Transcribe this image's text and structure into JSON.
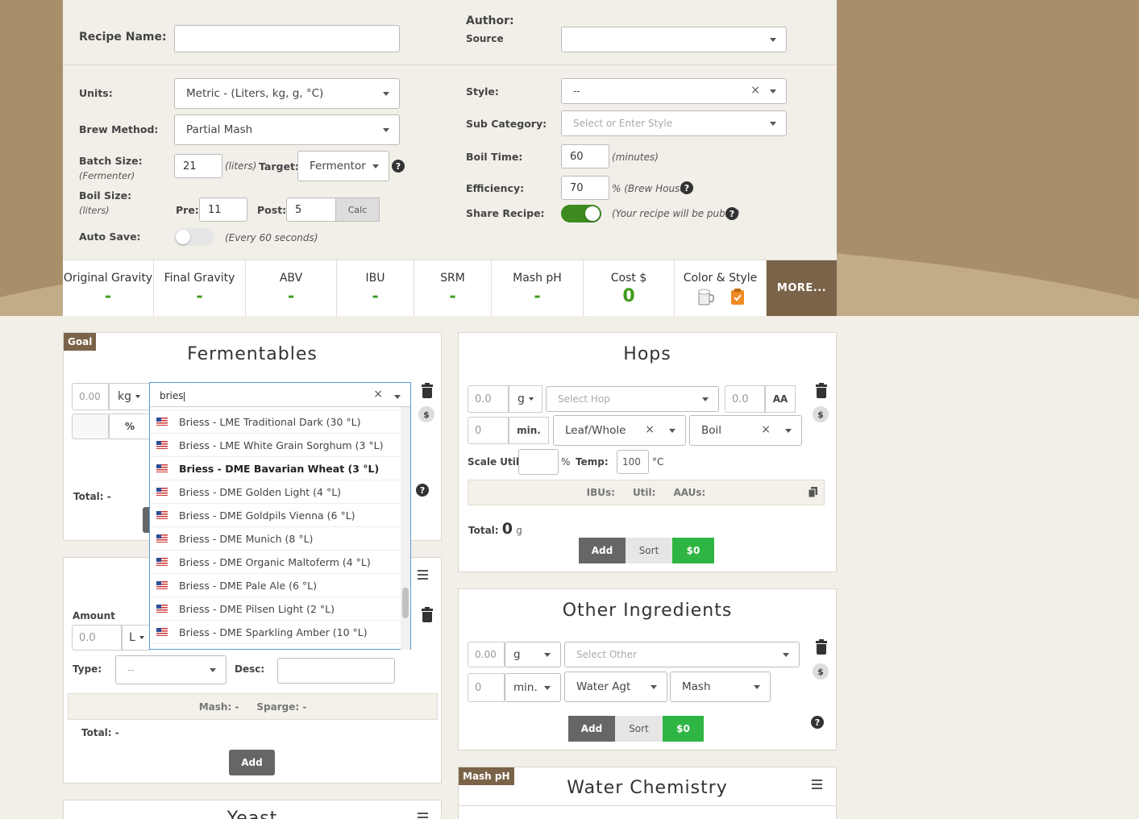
{
  "recipe": {
    "name_label": "Recipe Name:",
    "name_value": "",
    "author_label": "Author:",
    "source_label": "Source",
    "source_value": "",
    "units_label": "Units:",
    "units_value": "Metric - (Liters, kg, g, °C)",
    "method_label": "Brew Method:",
    "method_value": "Partial Mash",
    "batch_label": "Batch Size:",
    "batch_sub": "(Fermenter)",
    "batch_value": "21",
    "batch_unit": "(liters)",
    "target_label": "Target:",
    "target_value": "Fermentor",
    "boil_label": "Boil Size:",
    "boil_sub": "(liters)",
    "pre_label": "Pre:",
    "pre_value": "11",
    "post_label": "Post:",
    "post_value": "5",
    "calc_label": "Calc",
    "autosave_label": "Auto Save:",
    "autosave_note": "(Every 60 seconds)",
    "style_label": "Style:",
    "style_value": "--",
    "subcat_label": "Sub Category:",
    "subcat_placeholder": "Select or Enter Style",
    "boiltime_label": "Boil Time:",
    "boiltime_value": "60",
    "boiltime_unit": "(minutes)",
    "eff_label": "Efficiency:",
    "eff_value": "70",
    "eff_unit": "% (Brew House)",
    "share_label": "Share Recipe:",
    "share_note": "(Your recipe will be public)"
  },
  "stats": {
    "og_label": "Original Gravity",
    "og_value": "-",
    "fg_label": "Final Gravity",
    "fg_value": "-",
    "abv_label": "ABV",
    "abv_value": "-",
    "ibu_label": "IBU",
    "ibu_value": "-",
    "srm_label": "SRM",
    "srm_value": "-",
    "ph_label": "Mash pH",
    "ph_value": "-",
    "cost_label": "Cost $",
    "cost_value": "0",
    "color_label": "Color & Style",
    "more_label": "MORE..."
  },
  "fermentables": {
    "goal_badge": "Goal",
    "title": "Fermentables",
    "amount_placeholder": "0.00",
    "unit": "kg",
    "percent": "%",
    "search_value": "bries",
    "total_label": "Total:",
    "total_value": "-",
    "options": [
      "Briess - LME Traditional Dark (30 °L)",
      "Briess - LME White Grain Sorghum (3 °L)",
      "Briess - DME Bavarian Wheat (3 °L)",
      "Briess - DME Golden Light (4 °L)",
      "Briess - DME Goldpils Vienna (6 °L)",
      "Briess - DME Munich (8 °L)",
      "Briess - DME Organic Maltoferm (4 °L)",
      "Briess - DME Pale Ale (6 °L)",
      "Briess - DME Pilsen Light (2 °L)",
      "Briess - DME Sparkling Amber (10 °L)"
    ]
  },
  "water": {
    "amount_label": "Amount",
    "amount_placeholder": "0.0",
    "unit": "L",
    "type_label": "Type:",
    "type_value": "--",
    "desc_label": "Desc:",
    "mash_label": "Mash: -",
    "sparge_label": "Sparge: -",
    "total_label": "Total:",
    "total_value": "-",
    "add_label": "Add"
  },
  "yeast": {
    "title": "Yeast"
  },
  "hops": {
    "title": "Hops",
    "amount_placeholder": "0.0",
    "unit": "g",
    "select_placeholder": "Select Hop",
    "aa_placeholder": "0.0",
    "aa_label": "AA",
    "min_placeholder": "0",
    "min_label": "min.",
    "form_value": "Leaf/Whole",
    "use_value": "Boil",
    "scale_label": "Scale Util:",
    "pct": "%",
    "temp_label": "Temp:",
    "temp_value": "100",
    "temp_unit": "°C",
    "ibus_label": "IBUs:",
    "util_label": "Util:",
    "aaus_label": "AAUs:",
    "total_label": "Total:",
    "total_value": "0",
    "total_unit": "g",
    "add_label": "Add",
    "sort_label": "Sort",
    "cost_label": "$0"
  },
  "other": {
    "title": "Other Ingredients",
    "amount_placeholder": "0.00",
    "unit": "g",
    "select_placeholder": "Select Other",
    "time_placeholder": "0",
    "time_unit": "min.",
    "type_value": "Water Agt",
    "use_value": "Mash",
    "add_label": "Add",
    "sort_label": "Sort",
    "cost_label": "$0"
  },
  "waterchem": {
    "badge": "Mash pH",
    "title": "Water Chemistry"
  },
  "colors": {
    "accent_brown": "#7a6348",
    "green": "#2fb543",
    "value_green": "#3e9a1c"
  }
}
